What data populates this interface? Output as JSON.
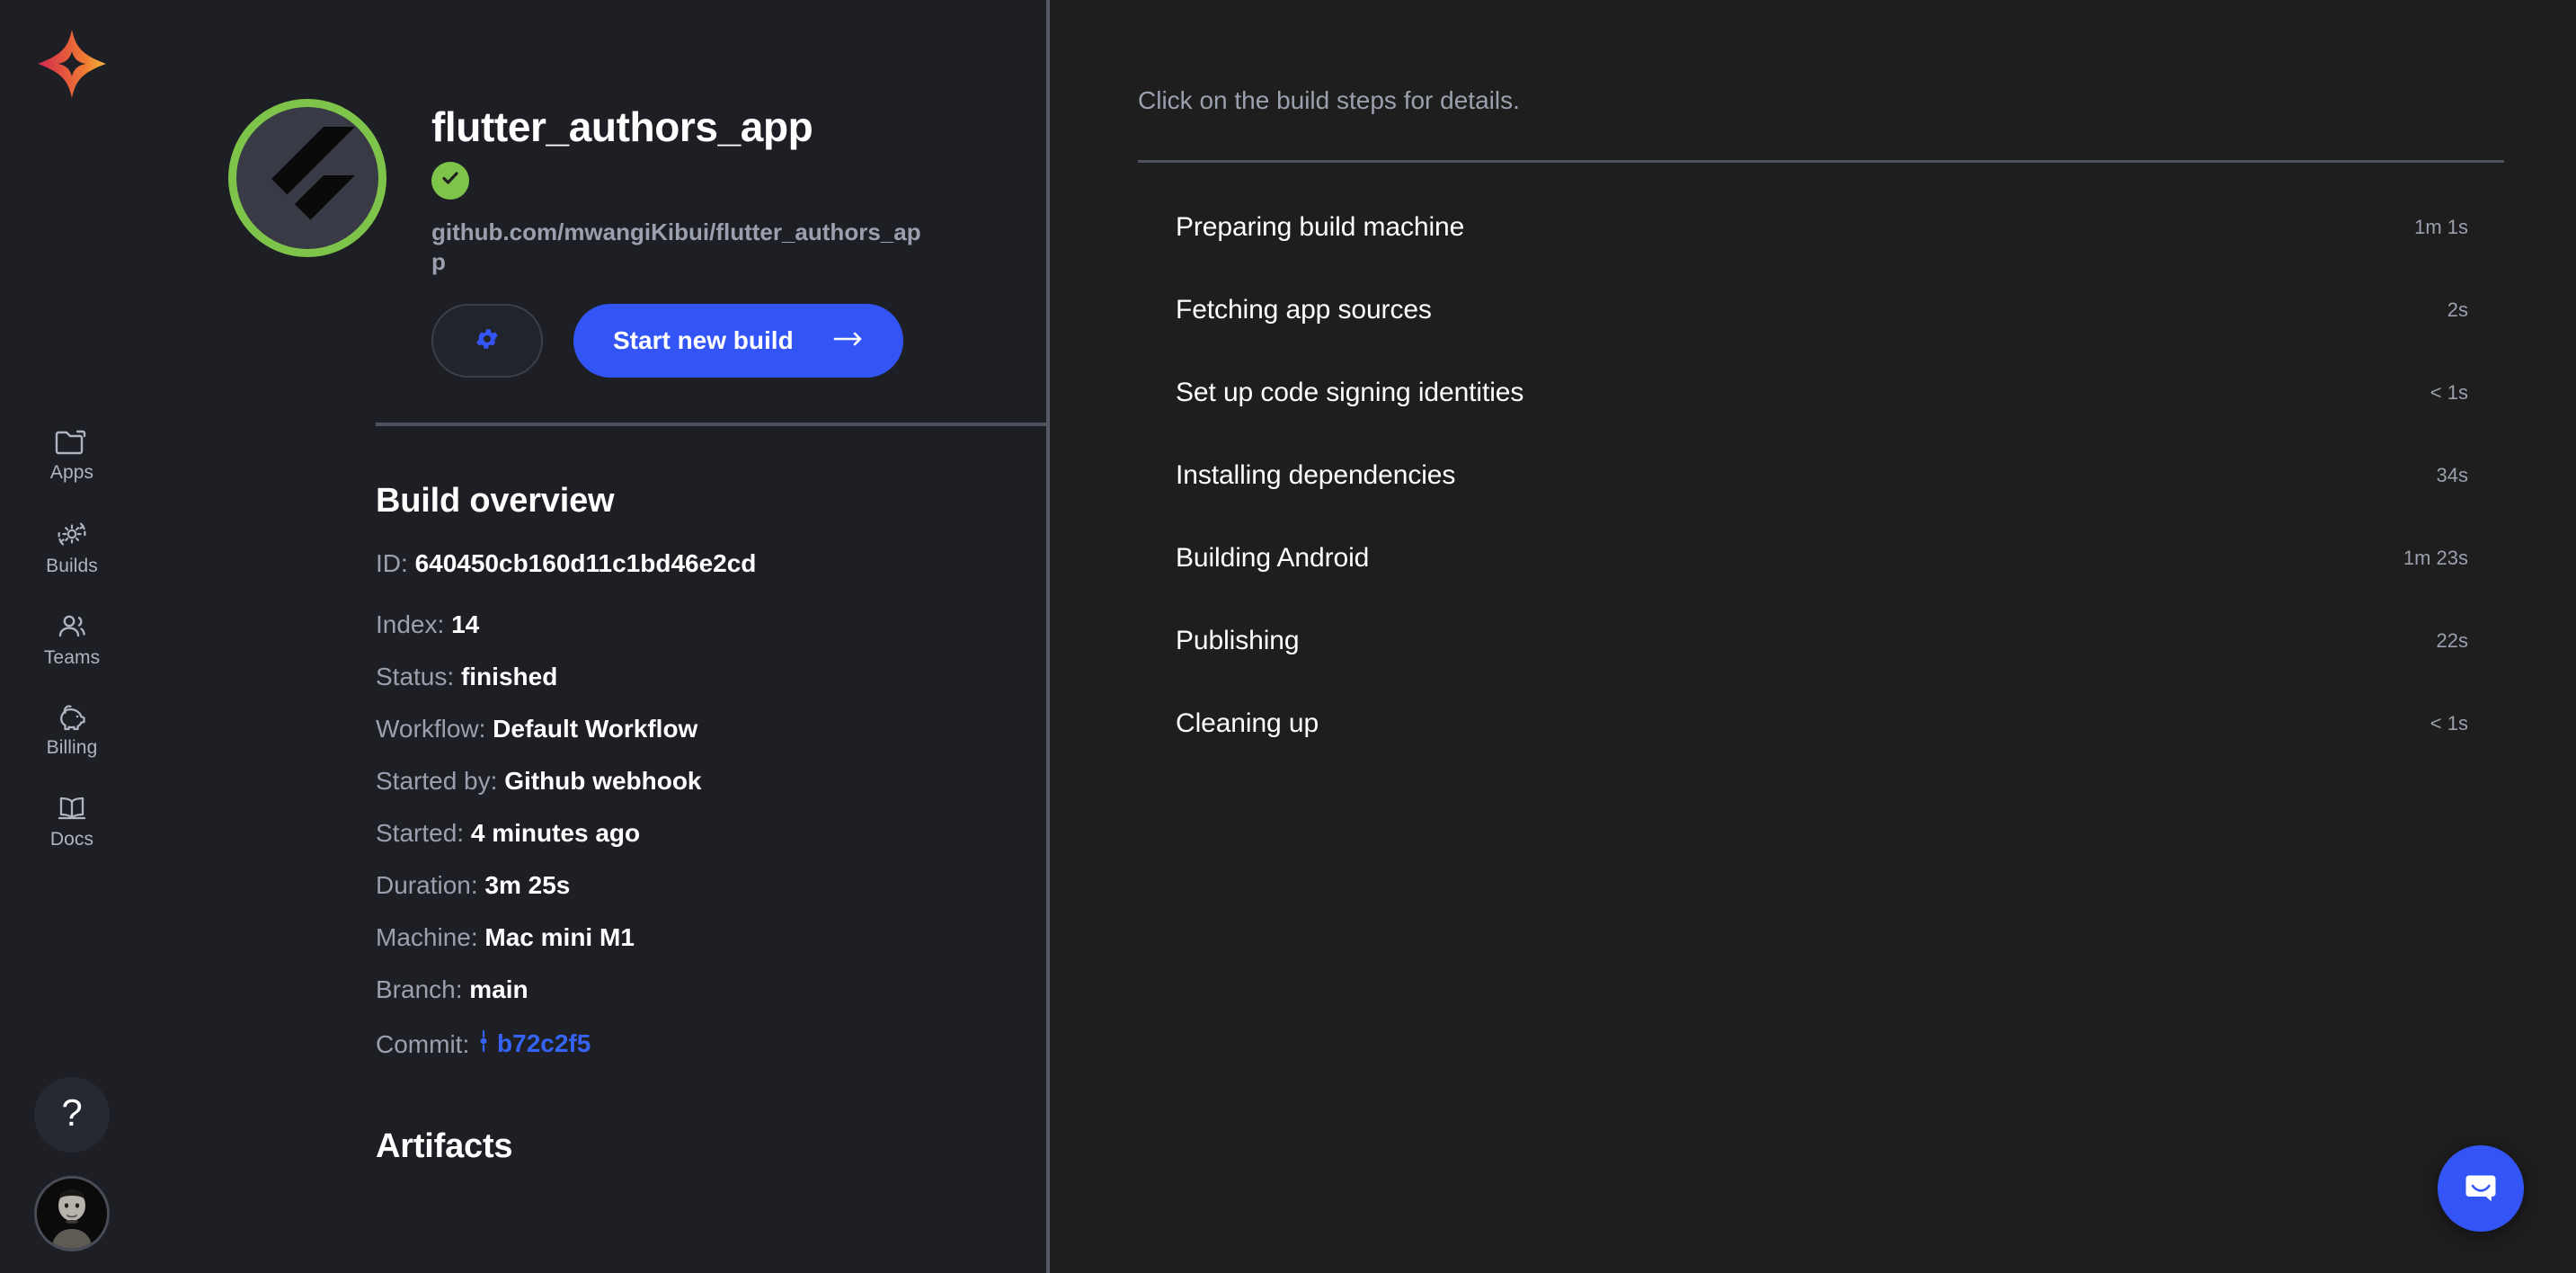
{
  "sidebar": {
    "logo_name": "codemagic-star-logo",
    "items": [
      {
        "label": "Apps",
        "icon": "folder-icon"
      },
      {
        "label": "Builds",
        "icon": "gear-refresh-icon"
      },
      {
        "label": "Teams",
        "icon": "people-icon"
      },
      {
        "label": "Billing",
        "icon": "piggy-bank-icon"
      },
      {
        "label": "Docs",
        "icon": "open-book-icon"
      }
    ],
    "help_label": "?",
    "avatar_name": "user-avatar"
  },
  "app": {
    "title": "flutter_authors_app",
    "repo_url": "github.com/mwangiKibui/flutter_authors_app",
    "status_icon": "check-circle-icon",
    "status_color": "#7fc44a",
    "app_icon": "flutter-logo-icon",
    "settings_icon": "gear-icon",
    "start_build_label": "Start new build",
    "start_build_arrow": "arrow-right-icon",
    "accent_color": "#3355f5"
  },
  "build_overview": {
    "heading": "Build overview",
    "rows": [
      {
        "key": "ID:",
        "value": "640450cb160d11c1bd46e2cd"
      },
      {
        "key": "Index:",
        "value": "14"
      },
      {
        "key": "Status:",
        "value": "finished"
      },
      {
        "key": "Workflow:",
        "value": "Default Workflow"
      },
      {
        "key": "Started by:",
        "value": "Github webhook"
      },
      {
        "key": "Started:",
        "value": "4 minutes ago"
      },
      {
        "key": "Duration:",
        "value": "3m 25s"
      },
      {
        "key": "Machine:",
        "value": "Mac mini M1"
      },
      {
        "key": "Branch:",
        "value": "main"
      }
    ],
    "commit_key": "Commit:",
    "commit_value": "b72c2f5",
    "commit_color": "#3563f5"
  },
  "artifacts": {
    "heading": "Artifacts"
  },
  "steps_panel": {
    "hint": "Click on the build steps for details.",
    "steps": [
      {
        "name": "Preparing build machine",
        "duration": "1m 1s"
      },
      {
        "name": "Fetching app sources",
        "duration": "2s"
      },
      {
        "name": "Set up code signing identities",
        "duration": "< 1s"
      },
      {
        "name": "Installing dependencies",
        "duration": "34s"
      },
      {
        "name": "Building Android",
        "duration": "1m 23s"
      },
      {
        "name": "Publishing",
        "duration": "22s"
      },
      {
        "name": "Cleaning up",
        "duration": "< 1s"
      }
    ]
  },
  "support": {
    "icon": "intercom-chat-icon",
    "color": "#3355f5"
  }
}
